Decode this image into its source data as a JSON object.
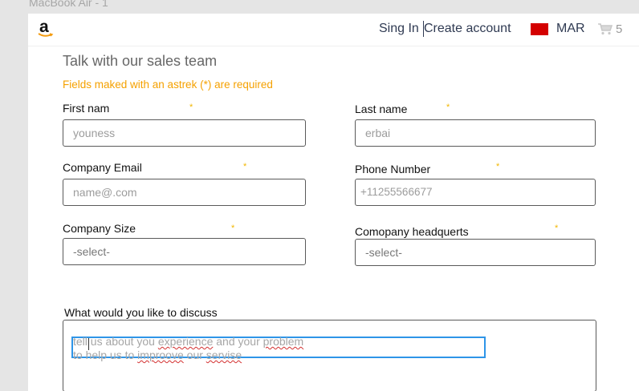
{
  "frame": {
    "label": "MacBook Air - 1"
  },
  "header": {
    "logo_letter": "a",
    "sign_in": "Sing In",
    "create_account": "Create account",
    "country": "MAR",
    "cart_count": "5",
    "flag_color": "#d40000"
  },
  "form": {
    "title": "Talk with our sales team",
    "required_note": "Fields maked with  an astrek (*) are required",
    "required_mark": "*",
    "fields": {
      "first_name": {
        "label": "First nam",
        "value": "youness"
      },
      "last_name": {
        "label": "Last name",
        "value": "erbai"
      },
      "company_email": {
        "label": "Company Email",
        "placeholder": "name@.com"
      },
      "phone_number": {
        "label": "Phone Number",
        "placeholder": "+11255566677"
      },
      "company_size": {
        "label": "Company Size",
        "value": "-select-"
      },
      "company_headquarters": {
        "label": "Comopany headquerts",
        "value": "-select-"
      }
    },
    "discuss": {
      "label": "What would you like to discuss",
      "line1_parts": [
        "tell",
        " us about you ",
        "experience",
        " and your ",
        "problem"
      ],
      "line2_parts": [
        "to help us to ",
        "improove",
        " our ",
        "servise"
      ]
    }
  },
  "colors": {
    "accent_orange": "#f5a100",
    "star_yellow": "#f2b600",
    "focus_blue": "#2e95e8",
    "nav_text": "#2f3a52"
  }
}
